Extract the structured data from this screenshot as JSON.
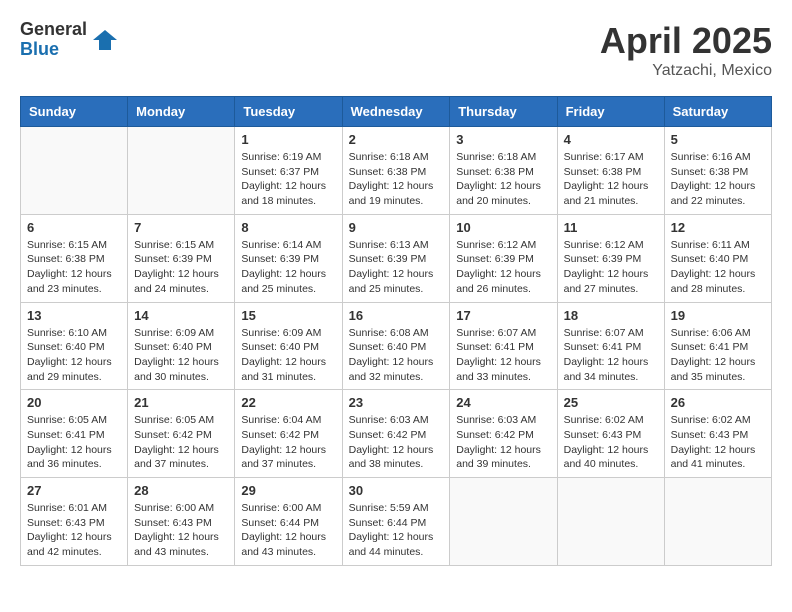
{
  "header": {
    "logo_general": "General",
    "logo_blue": "Blue",
    "title": "April 2025",
    "location": "Yatzachi, Mexico"
  },
  "days_of_week": [
    "Sunday",
    "Monday",
    "Tuesday",
    "Wednesday",
    "Thursday",
    "Friday",
    "Saturday"
  ],
  "weeks": [
    [
      {
        "day": "",
        "info": ""
      },
      {
        "day": "",
        "info": ""
      },
      {
        "day": "1",
        "sunrise": "Sunrise: 6:19 AM",
        "sunset": "Sunset: 6:37 PM",
        "daylight": "Daylight: 12 hours and 18 minutes."
      },
      {
        "day": "2",
        "sunrise": "Sunrise: 6:18 AM",
        "sunset": "Sunset: 6:38 PM",
        "daylight": "Daylight: 12 hours and 19 minutes."
      },
      {
        "day": "3",
        "sunrise": "Sunrise: 6:18 AM",
        "sunset": "Sunset: 6:38 PM",
        "daylight": "Daylight: 12 hours and 20 minutes."
      },
      {
        "day": "4",
        "sunrise": "Sunrise: 6:17 AM",
        "sunset": "Sunset: 6:38 PM",
        "daylight": "Daylight: 12 hours and 21 minutes."
      },
      {
        "day": "5",
        "sunrise": "Sunrise: 6:16 AM",
        "sunset": "Sunset: 6:38 PM",
        "daylight": "Daylight: 12 hours and 22 minutes."
      }
    ],
    [
      {
        "day": "6",
        "sunrise": "Sunrise: 6:15 AM",
        "sunset": "Sunset: 6:38 PM",
        "daylight": "Daylight: 12 hours and 23 minutes."
      },
      {
        "day": "7",
        "sunrise": "Sunrise: 6:15 AM",
        "sunset": "Sunset: 6:39 PM",
        "daylight": "Daylight: 12 hours and 24 minutes."
      },
      {
        "day": "8",
        "sunrise": "Sunrise: 6:14 AM",
        "sunset": "Sunset: 6:39 PM",
        "daylight": "Daylight: 12 hours and 25 minutes."
      },
      {
        "day": "9",
        "sunrise": "Sunrise: 6:13 AM",
        "sunset": "Sunset: 6:39 PM",
        "daylight": "Daylight: 12 hours and 25 minutes."
      },
      {
        "day": "10",
        "sunrise": "Sunrise: 6:12 AM",
        "sunset": "Sunset: 6:39 PM",
        "daylight": "Daylight: 12 hours and 26 minutes."
      },
      {
        "day": "11",
        "sunrise": "Sunrise: 6:12 AM",
        "sunset": "Sunset: 6:39 PM",
        "daylight": "Daylight: 12 hours and 27 minutes."
      },
      {
        "day": "12",
        "sunrise": "Sunrise: 6:11 AM",
        "sunset": "Sunset: 6:40 PM",
        "daylight": "Daylight: 12 hours and 28 minutes."
      }
    ],
    [
      {
        "day": "13",
        "sunrise": "Sunrise: 6:10 AM",
        "sunset": "Sunset: 6:40 PM",
        "daylight": "Daylight: 12 hours and 29 minutes."
      },
      {
        "day": "14",
        "sunrise": "Sunrise: 6:09 AM",
        "sunset": "Sunset: 6:40 PM",
        "daylight": "Daylight: 12 hours and 30 minutes."
      },
      {
        "day": "15",
        "sunrise": "Sunrise: 6:09 AM",
        "sunset": "Sunset: 6:40 PM",
        "daylight": "Daylight: 12 hours and 31 minutes."
      },
      {
        "day": "16",
        "sunrise": "Sunrise: 6:08 AM",
        "sunset": "Sunset: 6:40 PM",
        "daylight": "Daylight: 12 hours and 32 minutes."
      },
      {
        "day": "17",
        "sunrise": "Sunrise: 6:07 AM",
        "sunset": "Sunset: 6:41 PM",
        "daylight": "Daylight: 12 hours and 33 minutes."
      },
      {
        "day": "18",
        "sunrise": "Sunrise: 6:07 AM",
        "sunset": "Sunset: 6:41 PM",
        "daylight": "Daylight: 12 hours and 34 minutes."
      },
      {
        "day": "19",
        "sunrise": "Sunrise: 6:06 AM",
        "sunset": "Sunset: 6:41 PM",
        "daylight": "Daylight: 12 hours and 35 minutes."
      }
    ],
    [
      {
        "day": "20",
        "sunrise": "Sunrise: 6:05 AM",
        "sunset": "Sunset: 6:41 PM",
        "daylight": "Daylight: 12 hours and 36 minutes."
      },
      {
        "day": "21",
        "sunrise": "Sunrise: 6:05 AM",
        "sunset": "Sunset: 6:42 PM",
        "daylight": "Daylight: 12 hours and 37 minutes."
      },
      {
        "day": "22",
        "sunrise": "Sunrise: 6:04 AM",
        "sunset": "Sunset: 6:42 PM",
        "daylight": "Daylight: 12 hours and 37 minutes."
      },
      {
        "day": "23",
        "sunrise": "Sunrise: 6:03 AM",
        "sunset": "Sunset: 6:42 PM",
        "daylight": "Daylight: 12 hours and 38 minutes."
      },
      {
        "day": "24",
        "sunrise": "Sunrise: 6:03 AM",
        "sunset": "Sunset: 6:42 PM",
        "daylight": "Daylight: 12 hours and 39 minutes."
      },
      {
        "day": "25",
        "sunrise": "Sunrise: 6:02 AM",
        "sunset": "Sunset: 6:43 PM",
        "daylight": "Daylight: 12 hours and 40 minutes."
      },
      {
        "day": "26",
        "sunrise": "Sunrise: 6:02 AM",
        "sunset": "Sunset: 6:43 PM",
        "daylight": "Daylight: 12 hours and 41 minutes."
      }
    ],
    [
      {
        "day": "27",
        "sunrise": "Sunrise: 6:01 AM",
        "sunset": "Sunset: 6:43 PM",
        "daylight": "Daylight: 12 hours and 42 minutes."
      },
      {
        "day": "28",
        "sunrise": "Sunrise: 6:00 AM",
        "sunset": "Sunset: 6:43 PM",
        "daylight": "Daylight: 12 hours and 43 minutes."
      },
      {
        "day": "29",
        "sunrise": "Sunrise: 6:00 AM",
        "sunset": "Sunset: 6:44 PM",
        "daylight": "Daylight: 12 hours and 43 minutes."
      },
      {
        "day": "30",
        "sunrise": "Sunrise: 5:59 AM",
        "sunset": "Sunset: 6:44 PM",
        "daylight": "Daylight: 12 hours and 44 minutes."
      },
      {
        "day": "",
        "info": ""
      },
      {
        "day": "",
        "info": ""
      },
      {
        "day": "",
        "info": ""
      }
    ]
  ]
}
